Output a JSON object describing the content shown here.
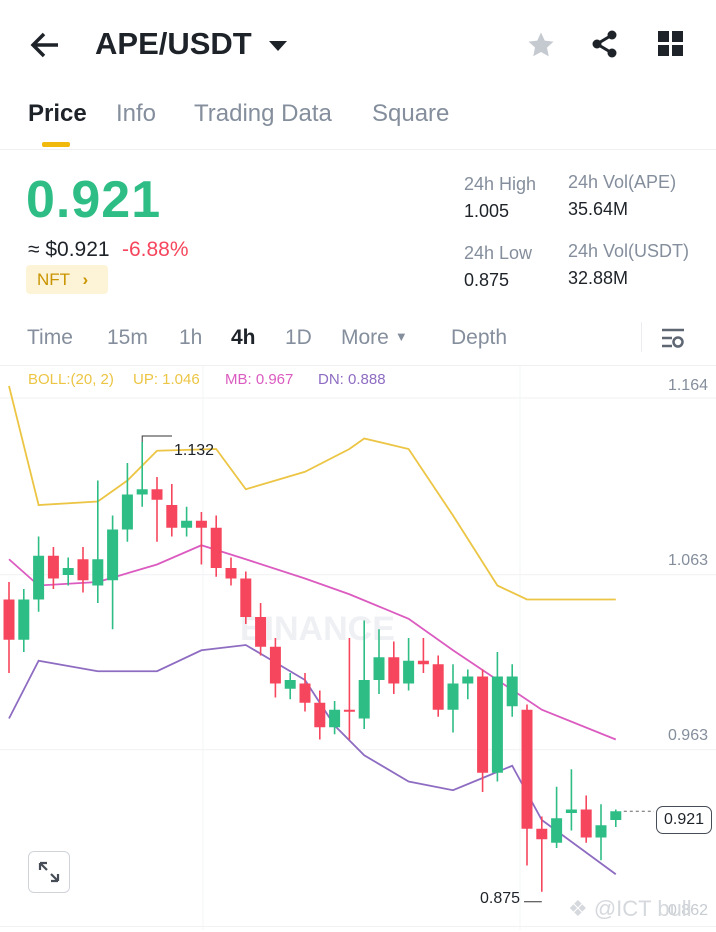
{
  "header": {
    "back_icon": "arrow-left-icon",
    "pair": "APE/USDT",
    "icons": [
      "star-icon",
      "share-icon",
      "grid-icon"
    ]
  },
  "tabs": [
    {
      "label": "Price"
    },
    {
      "label": "Info"
    },
    {
      "label": "Trading Data"
    },
    {
      "label": "Square"
    }
  ],
  "ticker": {
    "price": "0.921",
    "fiat": "≈ $0.921",
    "change": "-6.88%",
    "tag": "NFT",
    "tag_chevron": "›",
    "stats": {
      "high_label": "24h High",
      "high": "1.005",
      "low_label": "24h Low",
      "low": "0.875",
      "vol_base_label": "24h Vol(APE)",
      "vol_base": "35.64M",
      "vol_quote_label": "24h Vol(USDT)",
      "vol_quote": "32.88M"
    }
  },
  "intervals": [
    "Time",
    "15m",
    "1h",
    "4h",
    "1D",
    "More",
    "Depth"
  ],
  "active_interval": "4h",
  "indicator": {
    "boll": "BOLL:(20, 2)",
    "up": "UP: 1.046",
    "mb": "MB: 0.967",
    "dn": "DN: 0.888"
  },
  "axis_labels": [
    "1.164",
    "1.063",
    "0.963",
    "0.862"
  ],
  "markers": {
    "high": "1.132",
    "low": "0.875",
    "last": "0.921"
  },
  "watermark": "BINANCE",
  "user_watermark": "@ICT bull",
  "colors": {
    "up": "#2ebd85",
    "down": "#f6465d",
    "boll_up": "#ecc544",
    "boll_mb": "#db5bc0",
    "boll_dn": "#8e6cc2",
    "accent": "#f0b90b"
  },
  "chart_data": {
    "type": "candlestick",
    "ylim": [
      0.855,
      1.175
    ],
    "candles": [
      [
        1.042,
        1.052,
        1.0,
        1.019
      ],
      [
        1.019,
        1.048,
        1.012,
        1.042
      ],
      [
        1.042,
        1.078,
        1.035,
        1.067
      ],
      [
        1.067,
        1.072,
        1.048,
        1.054
      ],
      [
        1.056,
        1.066,
        1.05,
        1.06
      ],
      [
        1.065,
        1.072,
        1.046,
        1.053
      ],
      [
        1.05,
        1.11,
        1.04,
        1.065
      ],
      [
        1.053,
        1.09,
        1.025,
        1.082
      ],
      [
        1.082,
        1.12,
        1.075,
        1.102
      ],
      [
        1.102,
        1.132,
        1.095,
        1.105
      ],
      [
        1.105,
        1.112,
        1.075,
        1.099
      ],
      [
        1.096,
        1.108,
        1.078,
        1.083
      ],
      [
        1.083,
        1.095,
        1.078,
        1.087
      ],
      [
        1.087,
        1.092,
        1.062,
        1.083
      ],
      [
        1.083,
        1.09,
        1.055,
        1.06
      ],
      [
        1.06,
        1.066,
        1.05,
        1.054
      ],
      [
        1.054,
        1.058,
        1.028,
        1.032
      ],
      [
        1.032,
        1.04,
        1.01,
        1.015
      ],
      [
        1.015,
        1.02,
        0.986,
        0.994
      ],
      [
        0.991,
        1.0,
        0.985,
        0.996
      ],
      [
        0.994,
        1.0,
        0.978,
        0.983
      ],
      [
        0.983,
        0.99,
        0.962,
        0.969
      ],
      [
        0.969,
        0.984,
        0.965,
        0.979
      ],
      [
        0.979,
        1.02,
        0.962,
        0.978
      ],
      [
        0.974,
        1.03,
        0.968,
        0.996
      ],
      [
        0.996,
        1.025,
        0.988,
        1.009
      ],
      [
        1.009,
        1.018,
        0.988,
        0.994
      ],
      [
        0.994,
        1.02,
        0.99,
        1.007
      ],
      [
        1.007,
        1.02,
        1.0,
        1.005
      ],
      [
        1.005,
        1.01,
        0.975,
        0.979
      ],
      [
        0.979,
        1.005,
        0.966,
        0.994
      ],
      [
        0.994,
        1.002,
        0.985,
        0.998
      ],
      [
        0.998,
        1.002,
        0.932,
        0.943
      ],
      [
        0.943,
        1.012,
        0.938,
        0.998
      ],
      [
        0.981,
        1.005,
        0.975,
        0.998
      ],
      [
        0.979,
        0.982,
        0.89,
        0.911
      ],
      [
        0.911,
        0.918,
        0.875,
        0.905
      ],
      [
        0.903,
        0.935,
        0.9,
        0.917
      ],
      [
        0.92,
        0.945,
        0.91,
        0.922
      ],
      [
        0.922,
        0.93,
        0.903,
        0.906
      ],
      [
        0.906,
        0.925,
        0.893,
        0.913
      ],
      [
        0.916,
        0.922,
        0.912,
        0.921
      ]
    ],
    "boll_up": [
      [
        0,
        1.164
      ],
      [
        2,
        1.096
      ],
      [
        6,
        1.098
      ],
      [
        8,
        1.11
      ],
      [
        10,
        1.127
      ],
      [
        14,
        1.128
      ],
      [
        16,
        1.105
      ],
      [
        20,
        1.115
      ],
      [
        23,
        1.128
      ],
      [
        24,
        1.134
      ],
      [
        27,
        1.128
      ],
      [
        30,
        1.09
      ],
      [
        33,
        1.05
      ],
      [
        35,
        1.042
      ],
      [
        41,
        1.042
      ]
    ],
    "boll_mb": [
      [
        0,
        1.065
      ],
      [
        2,
        1.05
      ],
      [
        6,
        1.052
      ],
      [
        10,
        1.062
      ],
      [
        13,
        1.073
      ],
      [
        16,
        1.065
      ],
      [
        20,
        1.054
      ],
      [
        23,
        1.045
      ],
      [
        27,
        1.031
      ],
      [
        30,
        1.013
      ],
      [
        33,
        0.996
      ],
      [
        36,
        0.979
      ],
      [
        41,
        0.962
      ]
    ],
    "boll_dn": [
      [
        0,
        0.974
      ],
      [
        2,
        1.007
      ],
      [
        6,
        1.001
      ],
      [
        10,
        1.001
      ],
      [
        13,
        1.013
      ],
      [
        16,
        1.016
      ],
      [
        20,
        0.996
      ],
      [
        22,
        0.97
      ],
      [
        24,
        0.953
      ],
      [
        27,
        0.938
      ],
      [
        30,
        0.933
      ],
      [
        32,
        0.94
      ],
      [
        34,
        0.947
      ],
      [
        36,
        0.916
      ],
      [
        41,
        0.885
      ]
    ]
  }
}
